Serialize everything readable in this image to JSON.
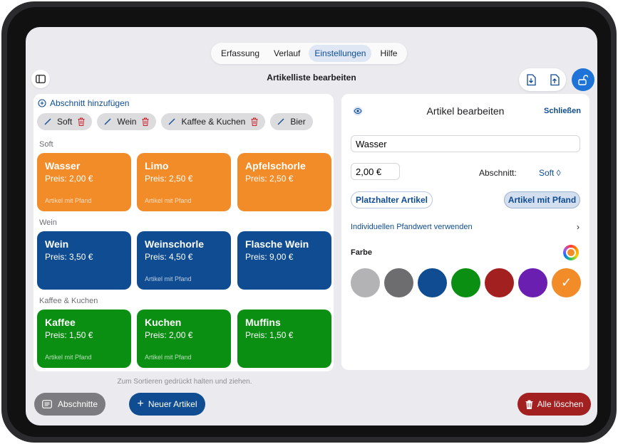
{
  "tabs": [
    {
      "label": "Erfassung",
      "active": false
    },
    {
      "label": "Verlauf",
      "active": false
    },
    {
      "label": "Einstellungen",
      "active": true
    },
    {
      "label": "Hilfe",
      "active": false
    }
  ],
  "header": {
    "title": "Artikelliste bearbeiten"
  },
  "left": {
    "add_section": "Abschnitt hinzufügen",
    "chips": [
      "Soft",
      "Wein",
      "Kaffee & Kuchen",
      "Bier"
    ],
    "sections": [
      {
        "label": "Soft",
        "items": [
          {
            "name": "Wasser",
            "price": "Preis: 2,00 €",
            "pfand": "Artikel mit Pfand",
            "color": "#f28c28"
          },
          {
            "name": "Limo",
            "price": "Preis: 2,50 €",
            "pfand": "Artikel mit Pfand",
            "color": "#f28c28"
          },
          {
            "name": "Apfelschorle",
            "price": "Preis: 2,50 €",
            "pfand": "",
            "color": "#f28c28"
          }
        ]
      },
      {
        "label": "Wein",
        "items": [
          {
            "name": "Wein",
            "price": "Preis: 3,50 €",
            "pfand": "",
            "color": "#0f4c92"
          },
          {
            "name": "Weinschorle",
            "price": "Preis: 4,50 €",
            "pfand": "Artikel mit Pfand",
            "color": "#0f4c92"
          },
          {
            "name": "Flasche Wein",
            "price": "Preis: 9,00 €",
            "pfand": "",
            "color": "#0f4c92"
          }
        ]
      },
      {
        "label": "Kaffee & Kuchen",
        "items": [
          {
            "name": "Kaffee",
            "price": "Preis: 1,50 €",
            "pfand": "Artikel mit Pfand",
            "color": "#0a8f12"
          },
          {
            "name": "Kuchen",
            "price": "Preis: 2,00 €",
            "pfand": "Artikel mit Pfand",
            "color": "#0a8f12"
          },
          {
            "name": "Muffins",
            "price": "Preis: 1,50 €",
            "pfand": "",
            "color": "#0a8f12"
          }
        ]
      }
    ],
    "hint": "Zum Sortieren gedrückt halten und ziehen."
  },
  "bottom": {
    "sections_label": "Abschnitte",
    "new_label": "Neuer Artikel",
    "delete_label": "Alle löschen"
  },
  "editor": {
    "title": "Artikel bearbeiten",
    "close_label": "Schließen",
    "name_value": "Wasser",
    "price_value": "2,00 €",
    "section_label": "Abschnitt:",
    "section_value": "Soft ◊",
    "placeholder_btn": "Platzhalter Artikel",
    "pfand_btn": "Artikel mit Pfand",
    "pfand_link": "Individuellen Pfandwert verwenden",
    "color_label": "Farbe",
    "colors": [
      "#b3b3b6",
      "#6d6d70",
      "#0f4c92",
      "#0a8f12",
      "#a32021",
      "#6a1fb0",
      "#f28c28"
    ],
    "selected_color_index": 6
  }
}
